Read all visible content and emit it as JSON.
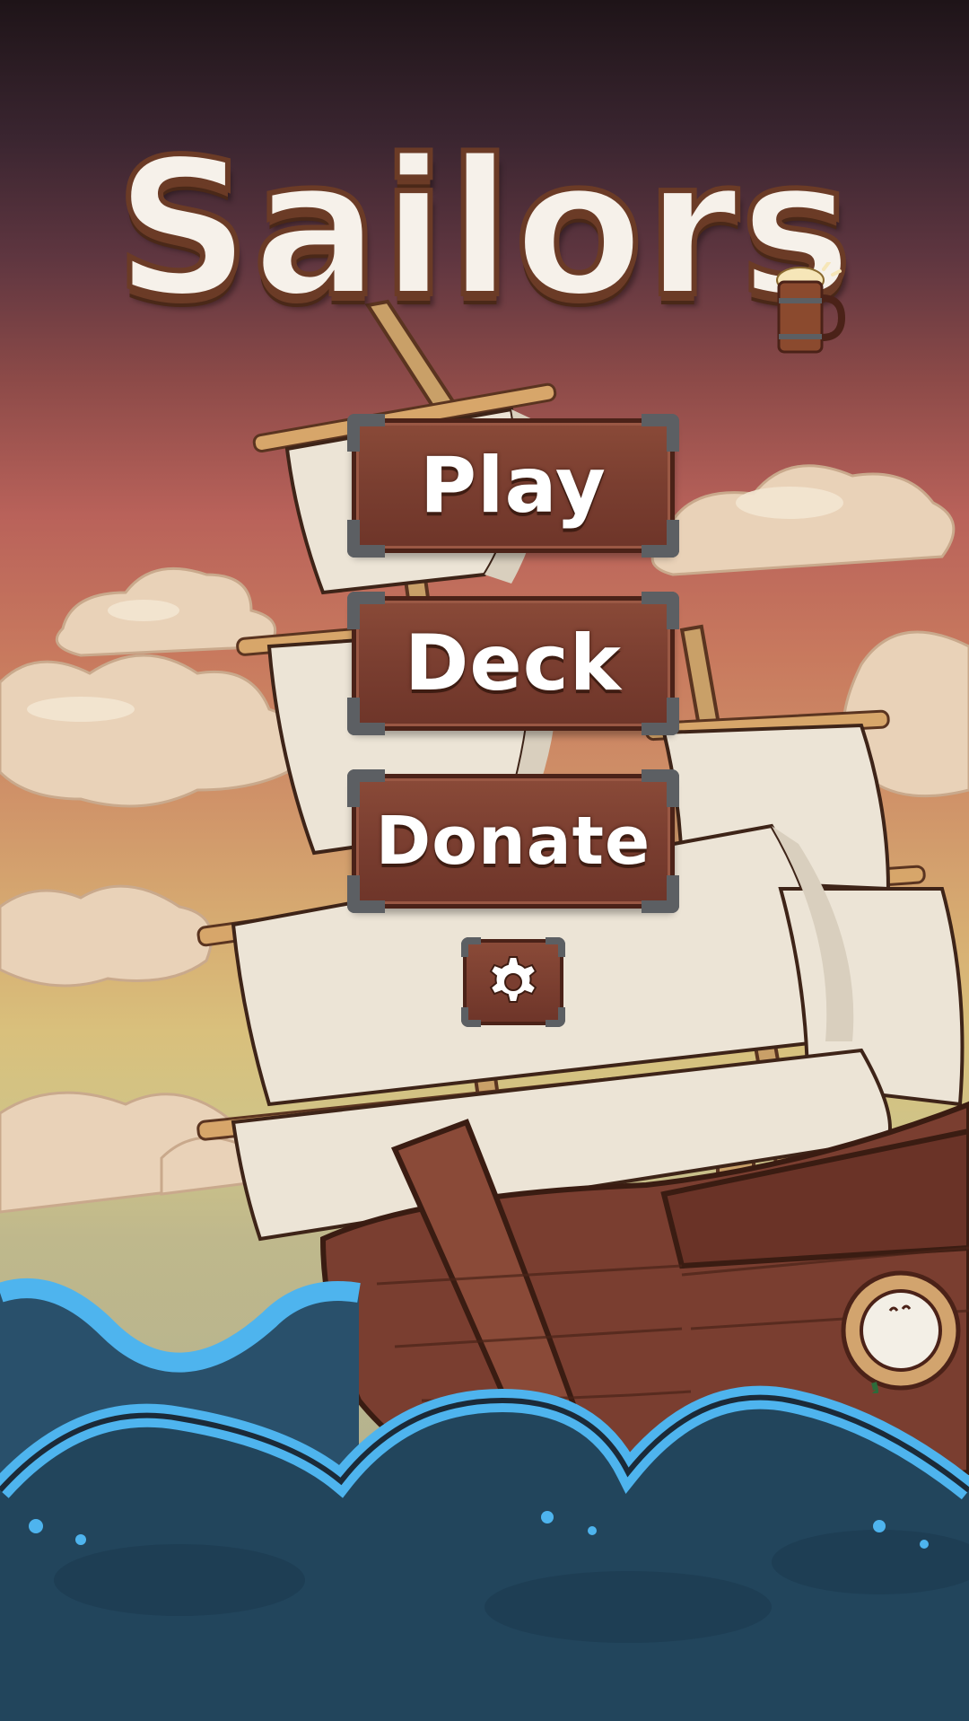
{
  "game": {
    "title": "Sailors"
  },
  "menu": {
    "play_label": "Play",
    "deck_label": "Deck",
    "donate_label": "Donate"
  },
  "icons": {
    "settings": "gear-icon",
    "mug": "beer-mug-icon",
    "porthole": "porthole-icon"
  },
  "colors": {
    "button_wood": "#7a3e30",
    "button_border": "#4b2218",
    "button_corners": "#5c5f63",
    "title_fill": "#f6f1ea",
    "title_outline": "#6b3b26",
    "sea_deep": "#22455c",
    "wave_highlight": "#4eb4ee",
    "sail": "#ece4d6",
    "hull": "#7a3e30"
  }
}
